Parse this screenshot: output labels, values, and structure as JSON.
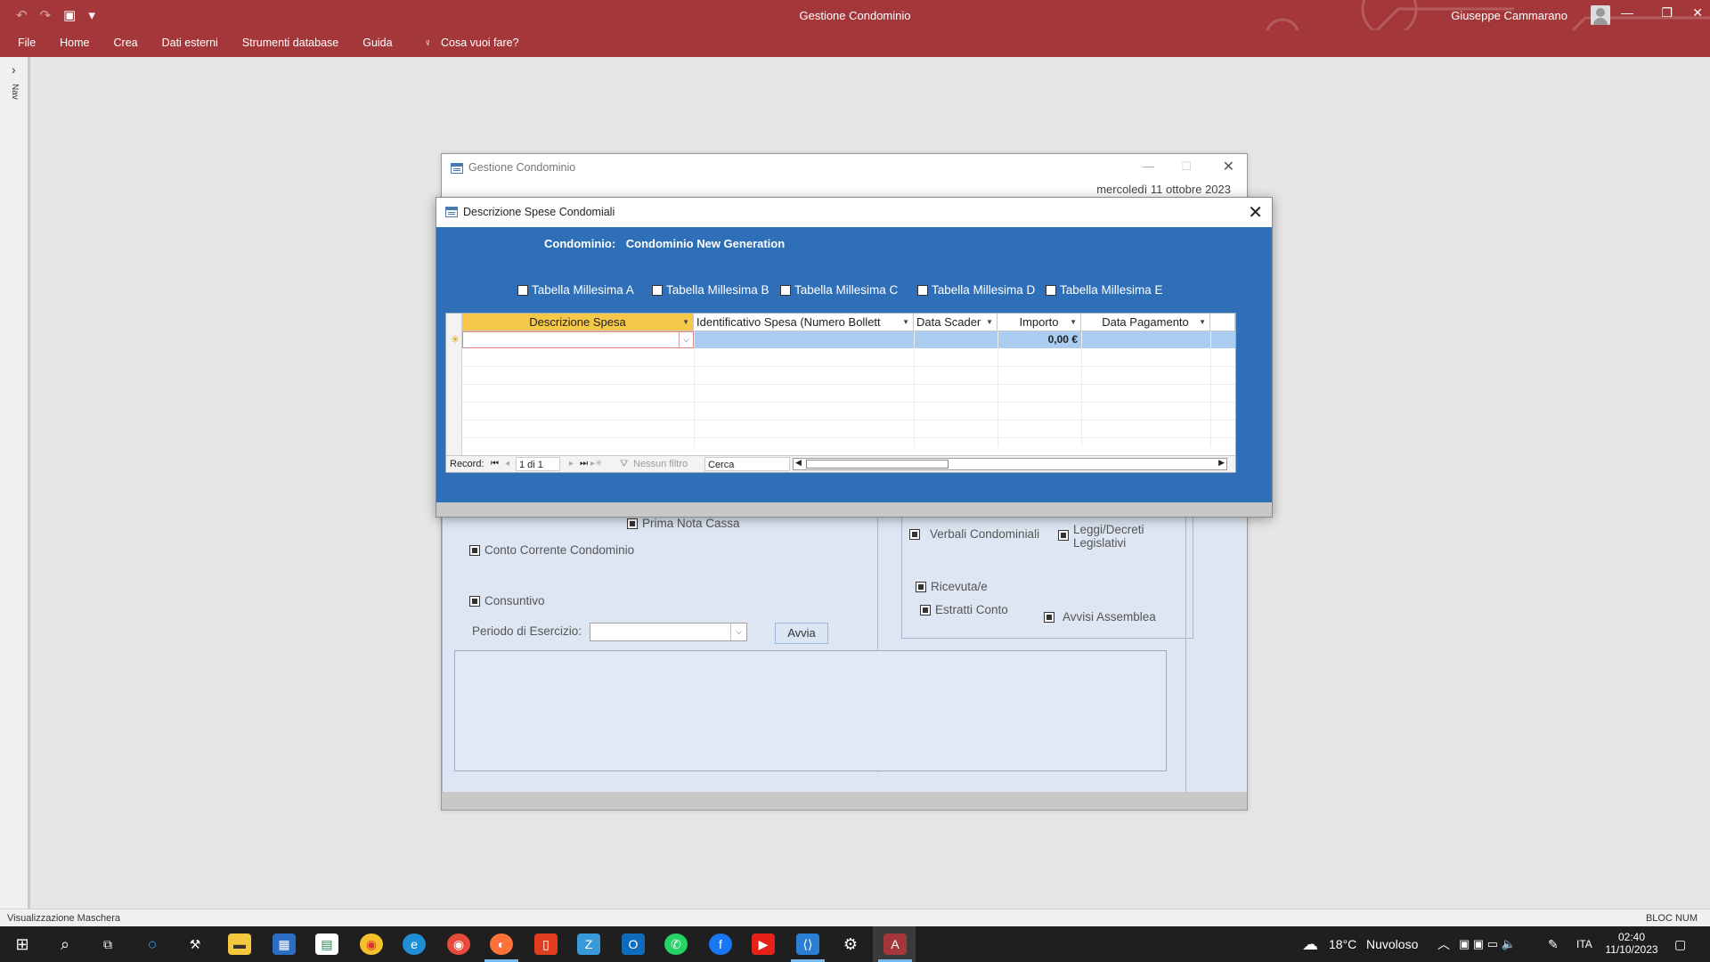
{
  "app": {
    "title": "Gestione Condominio",
    "user": "Giuseppe Cammarano",
    "colors": {
      "accent": "#a4373a",
      "form_blue": "#2e6fb7",
      "header_selected": "#f6c84a"
    }
  },
  "ribbon": {
    "tabs": [
      "File",
      "Home",
      "Crea",
      "Dati esterni",
      "Strumenti database",
      "Guida"
    ],
    "tell_me": "Cosa vuoi fare?"
  },
  "navpane": {
    "label": "Nav"
  },
  "bg_form": {
    "title": "Gestione Condominio",
    "date": "mercoledì 11 ottobre 2023",
    "checks": {
      "prima_nota": "Prima Nota Cassa",
      "conto_corrente": "Conto Corrente Condominio",
      "consuntivo": "Consuntivo",
      "verbali": "Verbali Condominiali",
      "leggi": "Leggi/Decreti Legislativi",
      "ricevute": "Ricevuta/e",
      "estratti": "Estratti Conto",
      "avvisi": "Avvisi Assemblea"
    },
    "periodo_label": "Periodo di Esercizio:",
    "periodo_value": "",
    "avvia_label": "Avvia"
  },
  "dialog": {
    "title": "Descrizione Spese Condomiali",
    "condominio_label": "Condominio:",
    "condominio_value": "Condominio New Generation",
    "tabelle": [
      "Tabella Millesima A",
      "Tabella Millesima B",
      "Tabella Millesima C",
      "Tabella Millesima D",
      "Tabella Millesima E"
    ],
    "columns": [
      "Descrizione  Spesa",
      "Identificativo Spesa (Numero Bollett",
      "Data Scader",
      "Importo",
      "Data Pagamento"
    ],
    "new_row": {
      "importo": "0,00 €"
    },
    "record_nav": {
      "label": "Record:",
      "position": "1 di 1",
      "filter": "Nessun filtro",
      "search": "Cerca"
    }
  },
  "statusbar": {
    "left": "Visualizzazione Maschera",
    "right": "BLOC NUM"
  },
  "taskbar": {
    "weather_temp": "18°C",
    "weather_text": "Nuvoloso",
    "lang": "ITA",
    "time": "02:40",
    "date": "11/10/2023"
  }
}
